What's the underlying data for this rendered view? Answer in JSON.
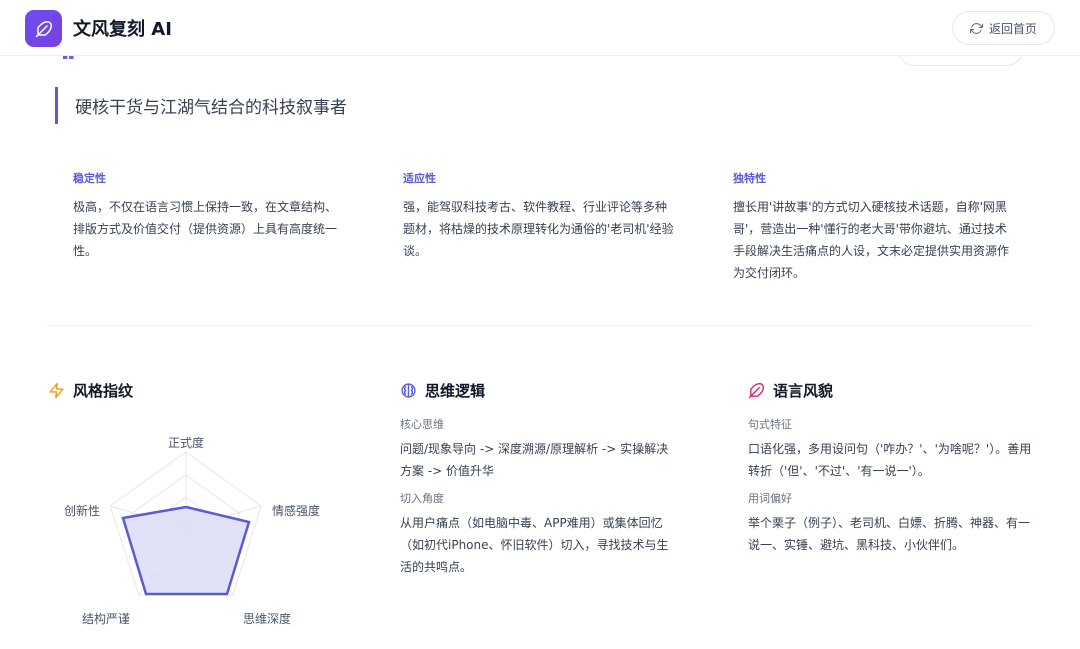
{
  "header": {
    "app_title": "文风复刻 AI",
    "back_label": "返回首页",
    "logo_icon": "feather-icon",
    "back_icon": "refresh-icon"
  },
  "tagline": "硬核干货与江湖气结合的科技叙事者",
  "traits": [
    {
      "label": "稳定性",
      "text": "极高，不仅在语言习惯上保持一致，在文章结构、排版方式及价值交付（提供资源）上具有高度统一性。"
    },
    {
      "label": "适应性",
      "text": "强，能驾驭科技考古、软件教程、行业评论等多种题材，将枯燥的技术原理转化为通俗的'老司机'经验谈。"
    },
    {
      "label": "独特性",
      "text": "擅长用'讲故事'的方式切入硬核技术话题，自称'网黑哥'，营造出一种'懂行的老大哥'带你避坑、通过技术手段解决生活痛点的人设，文末必定提供实用资源作为交付闭环。"
    }
  ],
  "style_fingerprint": {
    "title": "风格指纹",
    "icon": "lightning-icon",
    "axes": [
      "正式度",
      "情感强度",
      "思维深度",
      "结构严谨",
      "创新性"
    ]
  },
  "thinking_logic": {
    "title": "思维逻辑",
    "icon": "brain-icon",
    "items": [
      {
        "label": "核心思维",
        "text": "问题/现象导向 -> 深度溯源/原理解析 -> 实操解决方案 -> 价值升华"
      },
      {
        "label": "切入角度",
        "text": "从用户痛点（如电脑中毒、APP难用）或集体回忆（如初代iPhone、怀旧软件）切入，寻找技术与生活的共鸣点。"
      }
    ]
  },
  "language_style": {
    "title": "语言风貌",
    "icon": "feather-pen-icon",
    "items": [
      {
        "label": "句式特征",
        "text": "口语化强，多用设问句（'咋办？'、'为啥呢？'）。善用转折（'但'、'不过'、'有一说一'）。"
      },
      {
        "label": "用词偏好",
        "text": "举个栗子（例子）、老司机、白嫖、折腾、神器、有一说一、实锤、避坑、黑科技、小伙伴们。"
      }
    ]
  },
  "colors": {
    "accent": "#5b5bd6",
    "logo_gradient_start": "#6d4ef0",
    "radar_fill": "#dcdcf7",
    "lightning": "#f59e0b",
    "pink": "#db2777"
  }
}
